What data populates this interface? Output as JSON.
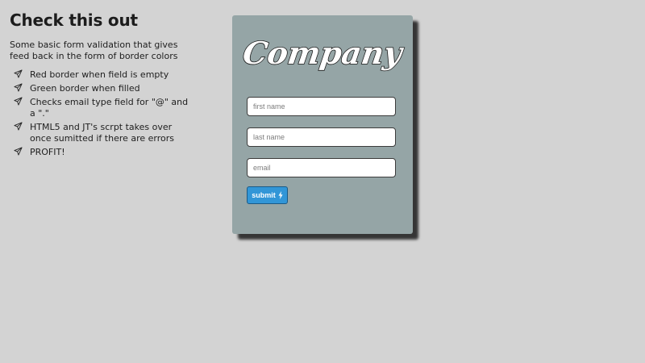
{
  "info": {
    "title": "Check this out",
    "description": "Some basic form validation that gives feed back in the form of border colors",
    "items": [
      {
        "text": "Red border when field is empty",
        "icon": "paper-plane-icon"
      },
      {
        "text": "Green border when filled",
        "icon": "paper-plane-icon"
      },
      {
        "text": "Checks email type field for \"@\" and a \".\"",
        "icon": "paper-plane-icon"
      },
      {
        "text": "HTML5 and JT's scrpt takes over once sumitted if there are errors",
        "icon": "paper-plane-icon"
      },
      {
        "text": "PROFIT!",
        "icon": "paper-plane-icon"
      }
    ]
  },
  "form": {
    "logo_text": "Company",
    "fields": [
      {
        "placeholder": "first name",
        "value": ""
      },
      {
        "placeholder": "last name",
        "value": ""
      },
      {
        "placeholder": "email",
        "value": ""
      }
    ],
    "submit_label": "submit",
    "submit_icon": "bolt-icon"
  },
  "colors": {
    "page_background": "#d3d3d3",
    "card_background": "#95a5a6",
    "button_background": "#3296d7",
    "text": "#1e1e1e"
  }
}
